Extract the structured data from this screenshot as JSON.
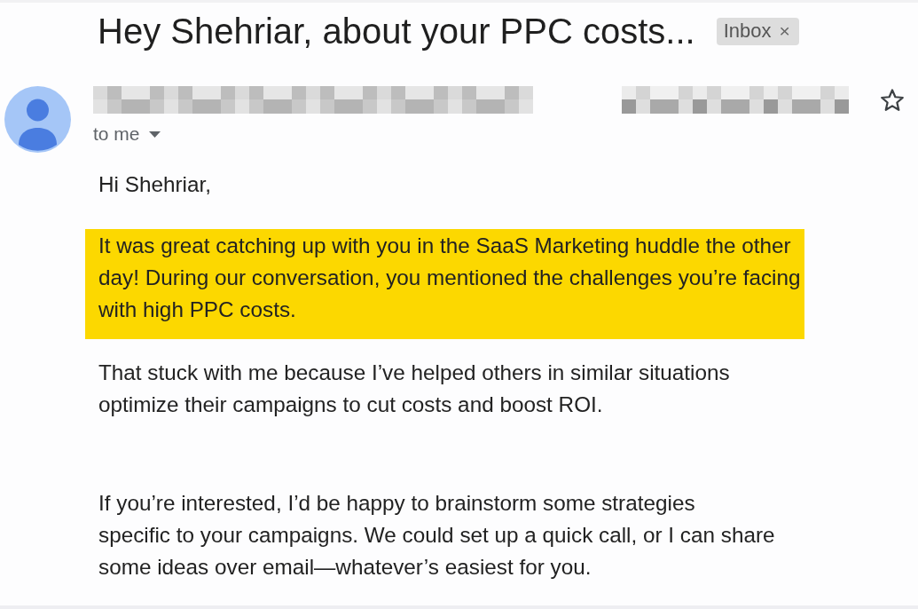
{
  "email": {
    "subject": "Hey Shehriar, about your PPC costs...",
    "label": {
      "text": "Inbox",
      "remove": "×"
    }
  },
  "sender": {
    "recipient_line": "to me",
    "starred": false
  },
  "body": {
    "greeting": "Hi Shehriar,",
    "paragraphs": [
      {
        "text": "It was great catching up with you in the SaaS Marketing huddle the other\nday! During our conversation, you mentioned the challenges you’re facing\nwith high PPC costs.",
        "highlighted": true
      },
      {
        "text": "That stuck with me because I’ve helped others in similar situations\noptimize their campaigns to cut costs and boost ROI.",
        "highlighted": false
      },
      {
        "text": "If you’re interested, I’d be happy to brainstorm some strategies\nspecific to your campaigns. We could set up a quick call, or I can share\nsome ideas over email—whatever’s easiest for you.",
        "highlighted": false
      }
    ]
  }
}
